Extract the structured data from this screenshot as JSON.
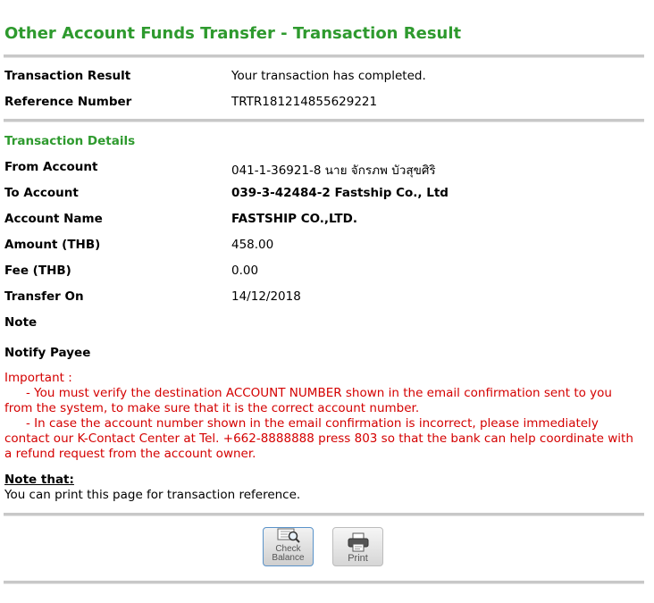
{
  "page": {
    "title": "Other Account Funds Transfer - Transaction Result"
  },
  "result": {
    "rows": [
      {
        "label": "Transaction Result",
        "value": "Your transaction has completed."
      },
      {
        "label": "Reference Number",
        "value": "TRTR181214855629221"
      }
    ]
  },
  "details": {
    "heading": "Transaction Details",
    "rows": [
      {
        "label": "From Account",
        "value": "041-1-36921-8 นาย จักรภพ บัวสุขศิริ"
      },
      {
        "label": "To Account",
        "value": "039-3-42484-2 Fastship Co., Ltd"
      },
      {
        "label": "Account Name",
        "value": "FASTSHIP CO.,LTD."
      },
      {
        "label": "Amount (THB)",
        "value": "458.00"
      },
      {
        "label": "Fee (THB)",
        "value": "0.00"
      },
      {
        "label": "Transfer On",
        "value": "14/12/2018"
      },
      {
        "label": "Note",
        "value": ""
      },
      {
        "label": "Notify Payee",
        "value": ""
      }
    ]
  },
  "important": {
    "heading": "Important :",
    "line1": "- You must verify the destination ACCOUNT NUMBER shown in the email confirmation sent to you from the system, to make sure that it is the correct account number.",
    "line2": "- In case the account number shown in the email confirmation is incorrect, please immediately contact our K-Contact Center at Tel. +662-8888888 press 803 so that the bank can help coordinate with a refund request from the account owner."
  },
  "note": {
    "title": "Note that:",
    "text": "You can print this page for transaction reference."
  },
  "buttons": {
    "check_balance_line1": "Check",
    "check_balance_line2": "Balance",
    "print": "Print"
  }
}
